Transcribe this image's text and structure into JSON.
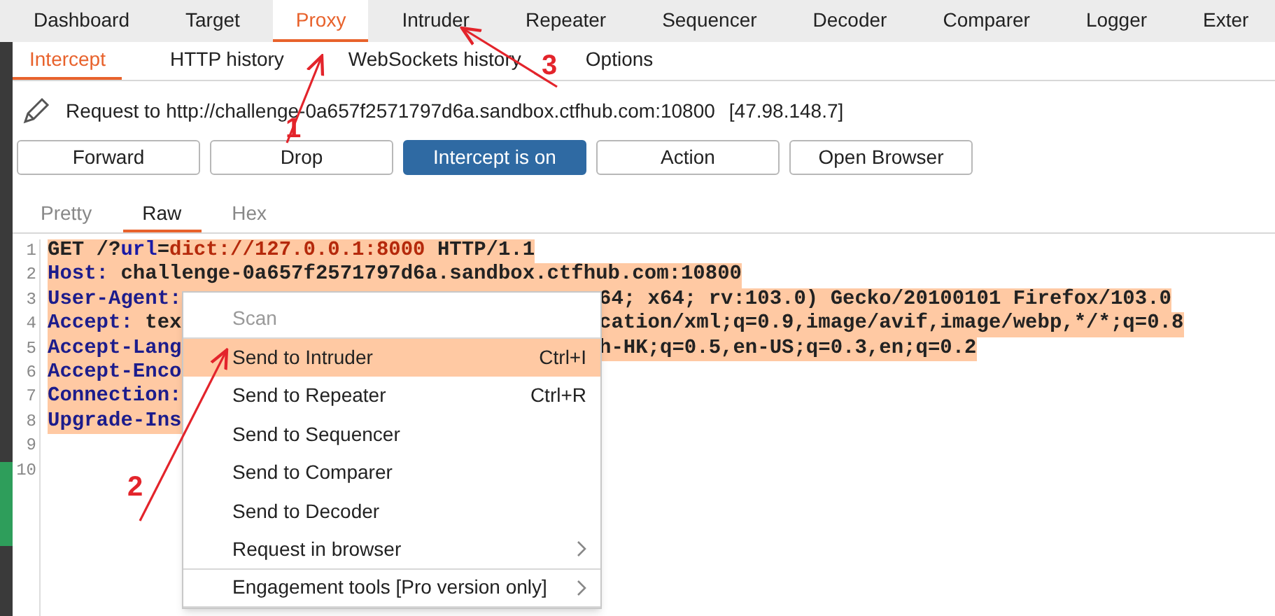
{
  "main_tabs": [
    {
      "label": "Dashboard",
      "selected": false
    },
    {
      "label": "Target",
      "selected": false
    },
    {
      "label": "Proxy",
      "selected": true
    },
    {
      "label": "Intruder",
      "selected": false
    },
    {
      "label": "Repeater",
      "selected": false
    },
    {
      "label": "Sequencer",
      "selected": false
    },
    {
      "label": "Decoder",
      "selected": false
    },
    {
      "label": "Comparer",
      "selected": false
    },
    {
      "label": "Logger",
      "selected": false
    },
    {
      "label": "Exter",
      "selected": false
    }
  ],
  "sub_tabs": [
    {
      "label": "Intercept",
      "selected": true
    },
    {
      "label": "HTTP history",
      "selected": false
    },
    {
      "label": "WebSockets history",
      "selected": false
    },
    {
      "label": "Options",
      "selected": false
    }
  ],
  "request": {
    "label": "Request to http://challenge-0a657f2571797d6a.sandbox.ctfhub.com:10800",
    "address": "[47.98.148.7]"
  },
  "buttons": [
    {
      "label": "Forward",
      "on": false
    },
    {
      "label": "Drop",
      "on": false
    },
    {
      "label": "Intercept is on",
      "on": true
    },
    {
      "label": "Action",
      "on": false
    },
    {
      "label": "Open Browser",
      "on": false
    }
  ],
  "editor_tabs": [
    {
      "label": "Pretty",
      "selected": false
    },
    {
      "label": "Raw",
      "selected": true
    },
    {
      "label": "Hex",
      "selected": false
    }
  ],
  "code_lines": [
    {
      "number": "1",
      "highlighted": true,
      "left": [
        {
          "kind": "text",
          "text": "GET /?"
        },
        {
          "kind": "param-name",
          "text": "url"
        },
        {
          "kind": "text",
          "text": "="
        },
        {
          "kind": "param-value",
          "text": "dict://127.0.0.1:8000"
        },
        {
          "kind": "text",
          "text": " HTTP/1.1"
        }
      ]
    },
    {
      "number": "2",
      "highlighted": true,
      "left": [
        {
          "kind": "header-name",
          "text": "Host:"
        },
        {
          "kind": "text",
          "text": " challenge-0a657f2571797d6a.sandbox.ctfhub.com:10800"
        }
      ]
    },
    {
      "number": "3",
      "highlighted": true,
      "left": [
        {
          "kind": "header-name",
          "text": "User-Agent:"
        }
      ],
      "right": "64; x64; rv:103.0) Gecko/20100101 Firefox/103.0"
    },
    {
      "number": "4",
      "highlighted": true,
      "left": [
        {
          "kind": "header-name",
          "text": "Accept:"
        },
        {
          "kind": "text",
          "text": " tex"
        }
      ],
      "right": "cation/xml;q=0.9,image/avif,image/webp,*/*;q=0.8"
    },
    {
      "number": "5",
      "highlighted": true,
      "left": [
        {
          "kind": "header-name",
          "text": "Accept-Lang"
        }
      ],
      "right": "h-HK;q=0.5,en-US;q=0.3,en;q=0.2"
    },
    {
      "number": "6",
      "highlighted": true,
      "left": [
        {
          "kind": "header-name",
          "text": "Accept-Enco"
        }
      ]
    },
    {
      "number": "7",
      "highlighted": true,
      "left": [
        {
          "kind": "header-name",
          "text": "Connection:"
        }
      ]
    },
    {
      "number": "8",
      "highlighted": true,
      "left": [
        {
          "kind": "header-name",
          "text": "Upgrade-Ins"
        }
      ]
    },
    {
      "number": "9"
    },
    {
      "number": "10"
    }
  ],
  "context_menu": [
    {
      "label": "Scan",
      "disabled": true,
      "selected": false,
      "submenu": false,
      "divider_after": true
    },
    {
      "label": "Send to Intruder",
      "shortcut": "Ctrl+I",
      "disabled": false,
      "selected": true,
      "submenu": false,
      "divider_after": false
    },
    {
      "label": "Send to Repeater",
      "shortcut": "Ctrl+R",
      "disabled": false,
      "selected": false,
      "submenu": false,
      "divider_after": false
    },
    {
      "label": "Send to Sequencer",
      "disabled": false,
      "selected": false,
      "submenu": false,
      "divider_after": false
    },
    {
      "label": "Send to Comparer",
      "disabled": false,
      "selected": false,
      "submenu": false,
      "divider_after": false
    },
    {
      "label": "Send to Decoder",
      "disabled": false,
      "selected": false,
      "submenu": false,
      "divider_after": false
    },
    {
      "label": "Request in browser",
      "disabled": false,
      "selected": false,
      "submenu": true,
      "divider_after": true
    },
    {
      "label": "Engagement tools [Pro version only]",
      "disabled": false,
      "selected": false,
      "submenu": true,
      "divider_after": true
    }
  ],
  "annotations": [
    {
      "number": "1"
    },
    {
      "number": "2"
    },
    {
      "number": "3"
    }
  ]
}
